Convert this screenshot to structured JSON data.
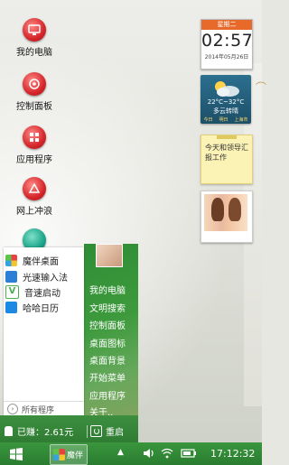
{
  "desktop_icons": [
    {
      "label": "我的电脑",
      "icon": "computer-icon"
    },
    {
      "label": "控制面板",
      "icon": "control-panel-icon"
    },
    {
      "label": "应用程序",
      "icon": "apps-icon"
    },
    {
      "label": "网上冲浪",
      "icon": "browser-icon"
    },
    {
      "label": "",
      "icon": "partial-icon"
    }
  ],
  "clock_widget": {
    "weekday": "星期二",
    "time": "02:57",
    "date": "2014年05月26日"
  },
  "weather_widget": {
    "temp": "22°C~32°C",
    "condition": "多云转晴",
    "day1": "今日",
    "day2": "明日",
    "city": "上海市"
  },
  "note_widget": {
    "text": "今天和领导汇报工作"
  },
  "start_menu": {
    "apps": [
      {
        "label": "魔伴桌面",
        "icon": "mobanzhuomian-icon",
        "color": "#e84a3c"
      },
      {
        "label": "光速输入法",
        "icon": "input-method-icon",
        "color": "#2c7fd6"
      },
      {
        "label": "音速启动",
        "icon": "launcher-icon",
        "color": "#4caf50"
      },
      {
        "label": "哈哈日历",
        "icon": "calendar-icon",
        "color": "#1e88e5"
      }
    ],
    "all_programs": "所有程序",
    "links": [
      "我的电脑",
      "文明搜索",
      "控制面板",
      "桌面图标",
      "桌面背景",
      "开始菜单",
      "应用程序",
      "关于.."
    ],
    "earned": "已赚：2.61元",
    "restart": "重启"
  },
  "taskbar": {
    "task_label": "魔伴",
    "clock": "17:12:32"
  },
  "colors": {
    "taskbar": "#2f8a34",
    "accent": "#d6262b"
  }
}
